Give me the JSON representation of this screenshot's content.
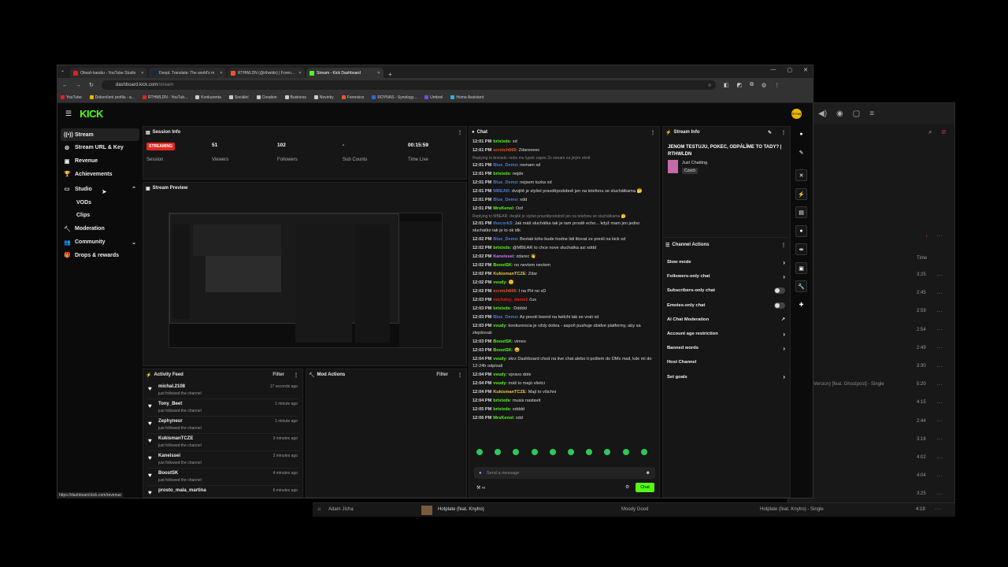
{
  "browser": {
    "tabs": [
      {
        "title": "Obsah kanálu - YouTube Studio",
        "color": "#e62117"
      },
      {
        "title": "DeepL Translate: The world's m",
        "color": "#0f2b46"
      },
      {
        "title": "RTHWLDN (@rthwldn) | Foren...",
        "color": "#e8552c"
      },
      {
        "title": "Stream - Kick Dashboard",
        "color": "#53fc18"
      }
    ],
    "url_host": "dashboard.kick.com",
    "url_path": "/stream",
    "bookmarks": [
      "YouTube",
      "Dokončení profilu - a...",
      "RTHWLDN - YouTub...",
      "Konkurenta",
      "Sociální",
      "Creation",
      "Business",
      "Novinky",
      "Forensics",
      "ROYNAS - Synology...",
      "Umbrel",
      "Home Assistant"
    ],
    "status_url": "https://dashboard.kick.com/revenue"
  },
  "app": {
    "logo": "KICK",
    "avatar_text": "RTHW"
  },
  "sidebar": {
    "items": [
      {
        "label": "Stream",
        "icon": "((•))"
      },
      {
        "label": "Stream URL & Key",
        "icon": "⚙"
      },
      {
        "label": "Revenue",
        "icon": "▣"
      },
      {
        "label": "Achievements",
        "icon": "🏆"
      },
      {
        "label": "Studio",
        "icon": "▭"
      },
      {
        "label": "VODs",
        "icon": ""
      },
      {
        "label": "Clips",
        "icon": ""
      },
      {
        "label": "Moderation",
        "icon": "🔨"
      },
      {
        "label": "Community",
        "icon": "👥"
      },
      {
        "label": "Drops & rewards",
        "icon": "🎁"
      }
    ]
  },
  "session": {
    "title": "Session Info",
    "status": "STREAMING",
    "status_label": "Session",
    "viewers": "51",
    "viewers_label": "Viewers",
    "followers": "102",
    "followers_label": "Followers",
    "subs": "-",
    "subs_label": "Sub Counts",
    "time": "00:15:59",
    "time_label": "Time Live"
  },
  "preview": {
    "title": "Stream Preview"
  },
  "activity": {
    "title": "Activity Feed",
    "filter": "Filter",
    "items": [
      {
        "name": "michal.2108",
        "action": "just followed the channel",
        "time": "17 seconds ago"
      },
      {
        "name": "Tony_Beet",
        "action": "just followed the channel",
        "time": "1 minute ago"
      },
      {
        "name": "Zephyneur",
        "action": "just followed the channel",
        "time": "1 minute ago"
      },
      {
        "name": "KukismanTCZE",
        "action": "just followed the channel",
        "time": "3 minutes ago"
      },
      {
        "name": "Kaneissei",
        "action": "just followed the channel",
        "time": "3 minutes ago"
      },
      {
        "name": "BoostSK",
        "action": "just followed the channel",
        "time": "4 minutes ago"
      },
      {
        "name": "prosto_mala_martina",
        "action": "",
        "time": "6 minutes ago"
      }
    ]
  },
  "mod": {
    "title": "Mod Actions",
    "filter": "Filter"
  },
  "chat": {
    "title": "Chat",
    "placeholder": "Send a message",
    "send": "Chat",
    "messages": [
      {
        "time": "12:01 PM",
        "user": "brixixds",
        "color": "#53fc18",
        "text": "xd"
      },
      {
        "time": "12:01 PM",
        "user": "scrxtch666",
        "color": "#e8552c",
        "text": "Zdareeeec"
      },
      {
        "reply": "Replying to brixixds: nebo mu typek zapne 2x stream na jiným okně"
      },
      {
        "time": "12:01 PM",
        "user": "Blue_Demo",
        "color": "#4a7bd8",
        "text": "nemam xd"
      },
      {
        "time": "12:01 PM",
        "user": "brixixds",
        "color": "#53fc18",
        "text": "nejde"
      },
      {
        "time": "12:01 PM",
        "user": "Blue_Demo",
        "color": "#4a7bd8",
        "text": "nejsem tuzka xd"
      },
      {
        "time": "12:01 PM",
        "user": "MBEAR",
        "color": "#4a7bd8",
        "text": "dvojitě je slyšet pravděpodobně jen na telefonu se sluchátkama 🤔"
      },
      {
        "time": "12:01 PM",
        "user": "Blue_Demo",
        "color": "#4a7bd8",
        "text": "xdd"
      },
      {
        "time": "12:01 PM",
        "user": "MrsKenol",
        "color": "#53fc18",
        "text": "Oof"
      },
      {
        "reply": "Replying to MBEAR: dvojitě je slyšet pravděpodobně jen na telefonu se sluchátkama 🤔"
      },
      {
        "time": "12:01 PM",
        "user": "thocorkS",
        "color": "#4a7bd8",
        "text": "Jak máš sluchátka tak je tam prostě echo... když mam jen jedno sluchatko tak je to ok idk"
      },
      {
        "time": "12:02 PM",
        "user": "Blue_Demo",
        "color": "#4a7bd8",
        "text": "Beztak toho bude hodne lidi litovat ze presli na kick xd"
      },
      {
        "time": "12:02 PM",
        "user": "brixixds",
        "color": "#53fc18",
        "text": "@MBEAR to chce nove sluchatka asi xddd"
      },
      {
        "time": "12:02 PM",
        "user": "Kaneissei",
        "color": "#c77dff",
        "text": "zdarec 👋"
      },
      {
        "time": "12:02 PM",
        "user": "BoostSK",
        "color": "#53fc18",
        "text": "no nevíem nevíem"
      },
      {
        "time": "12:02 PM",
        "user": "KukismanTCZE",
        "color": "#e8c547",
        "text": "Zdar"
      },
      {
        "time": "12:02 PM",
        "user": "vvudy",
        "color": "#53fc18",
        "text": "🙂"
      },
      {
        "time": "12:02 PM",
        "user": "scrxtch666",
        "color": "#e8552c",
        "text": "I na PH no xD"
      },
      {
        "time": "12:03 PM",
        "user": "michalzy_daniel",
        "color": "#e62117",
        "text": "čus"
      },
      {
        "time": "12:03 PM",
        "user": "brixixds",
        "color": "#53fc18",
        "text": ":Ddddd"
      },
      {
        "time": "12:03 PM",
        "user": "Blue_Demo",
        "color": "#4a7bd8",
        "text": "Az povoli bword na twitchi tak se vrati xd"
      },
      {
        "time": "12:03 PM",
        "user": "vvudy",
        "color": "#53fc18",
        "text": "konkurencia je vždy dobra - aspoň pushuje obidve platformy, aby sa zlepšovali"
      },
      {
        "time": "12:03 PM",
        "user": "BoostSK",
        "color": "#53fc18",
        "text": "vimeo"
      },
      {
        "time": "12:03 PM",
        "user": "BoostSK",
        "color": "#53fc18",
        "text": "😄"
      },
      {
        "time": "12:04 PM",
        "user": "vvudy",
        "color": "#53fc18",
        "text": "skrz Dashboard chod na live chat alebo ti pošlem do DMs mail, kde mi do 12-24h odpísali"
      },
      {
        "time": "12:04 PM",
        "user": "vvudy",
        "color": "#53fc18",
        "text": "vpravo dole"
      },
      {
        "time": "12:04 PM",
        "user": "vvudy",
        "color": "#53fc18",
        "text": "máš to majú všetci"
      },
      {
        "time": "12:04 PM",
        "user": "KukismanTCZE",
        "color": "#e8c547",
        "text": "Mají to všichni"
      },
      {
        "time": "12:04 PM",
        "user": "brixixds",
        "color": "#53fc18",
        "text": "musis nastavit"
      },
      {
        "time": "12:05 PM",
        "user": "brixixds",
        "color": "#53fc18",
        "text": "xdddd"
      },
      {
        "time": "12:06 PM",
        "user": "MrsKenol",
        "color": "#53fc18",
        "text": "xdd"
      }
    ]
  },
  "stream_info": {
    "title": "Stream Info",
    "stream_title": "JENOM TESTUJU, POKEC, ODPÁLÍME TO TADY? | RTHWLDN",
    "category": "Just Chatting",
    "language": "Czech"
  },
  "channel_actions": {
    "title": "Channel Actions",
    "items": [
      {
        "label": "Slow mode",
        "ctl": "chevron"
      },
      {
        "label": "Followers-only chat",
        "ctl": "chevron"
      },
      {
        "label": "Subscribers-only chat",
        "ctl": "toggle"
      },
      {
        "label": "Emotes-only chat",
        "ctl": "toggle"
      },
      {
        "label": "AI Chat Moderation",
        "ctl": "external"
      },
      {
        "label": "Account age restriction",
        "ctl": "chevron"
      },
      {
        "label": "Banned words",
        "ctl": "chevron"
      },
      {
        "label": "Host Channel",
        "ctl": ""
      },
      {
        "label": "Set goals",
        "ctl": "chevron"
      }
    ]
  },
  "bg_music": {
    "time_header": "Time",
    "tracks": [
      {
        "title": "",
        "time": "3:25"
      },
      {
        "title": "",
        "time": "2:45"
      },
      {
        "title": "",
        "time": "2:59"
      },
      {
        "title": "",
        "time": "2:54"
      },
      {
        "title": "",
        "time": "2:49"
      },
      {
        "title": "",
        "time": "3:30"
      },
      {
        "title": "Version) [feat. Ghostpost] - Single",
        "time": "5:20"
      },
      {
        "title": "",
        "time": "4:15"
      },
      {
        "title": "",
        "time": "2:44"
      },
      {
        "title": "",
        "time": "3:16"
      },
      {
        "title": "",
        "time": "4:02"
      },
      {
        "title": "",
        "time": "4:04"
      },
      {
        "title": "",
        "time": "3:25"
      }
    ],
    "now_playing_artist_left": "Adam Jícha",
    "now_playing_title": "Hotplate (feat. Knytro)",
    "now_playing_album": "Moody Good",
    "now_playing_right": "Hotplate (feat. Knytro) - Single",
    "now_playing_time": "4:19"
  }
}
